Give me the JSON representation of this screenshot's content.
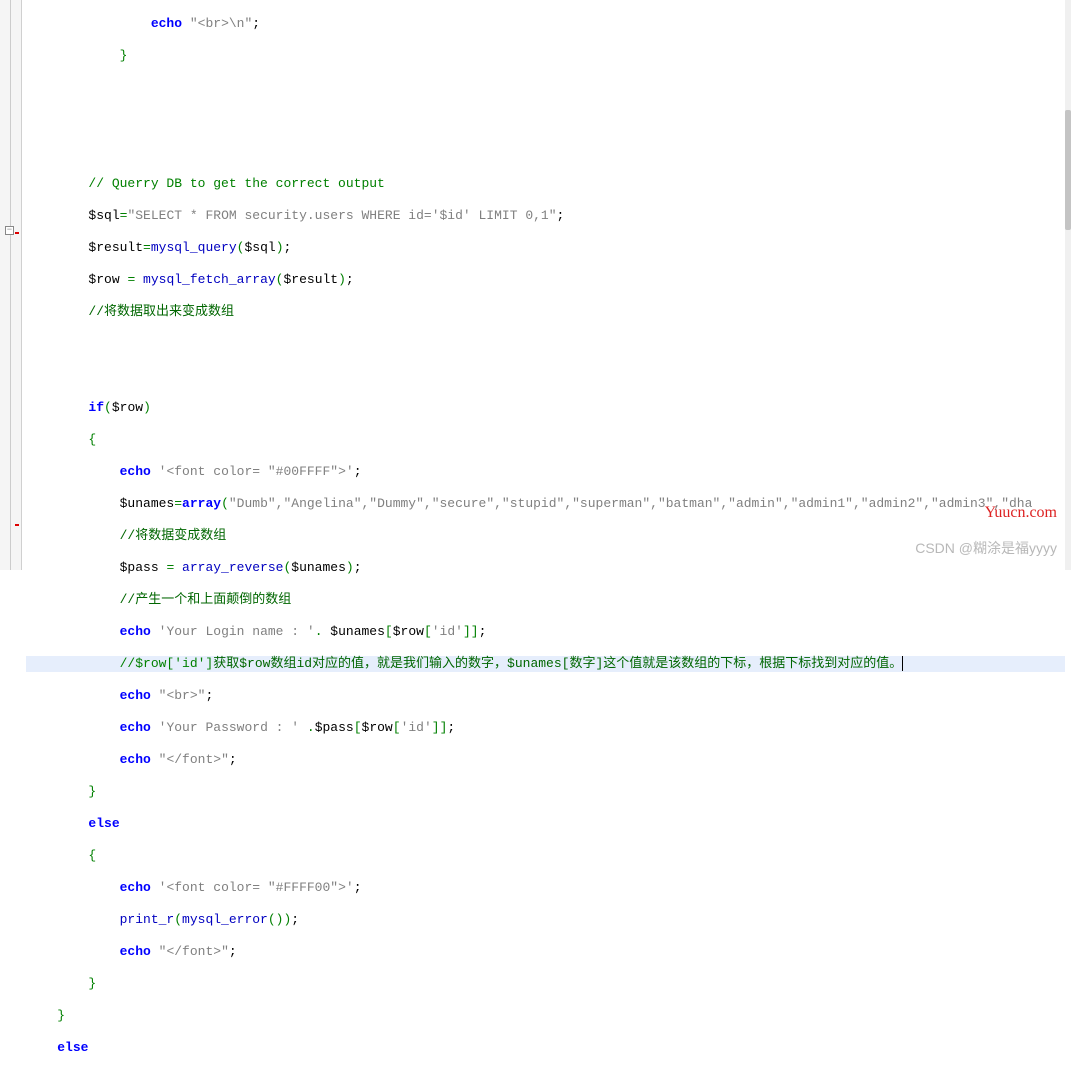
{
  "code": {
    "l0": {
      "indent": "                ",
      "kw": "echo",
      "str": "\"<br>\\n\"",
      "semi": ";"
    },
    "l1": {
      "indent": "            ",
      "brace": "}"
    },
    "l5_cmt": "        // Querry DB to get the correct output",
    "l6": {
      "indent": "        ",
      "var": "$sql",
      "op": "=",
      "str": "\"SELECT * FROM security.users WHERE id='$id' LIMIT 0,1\"",
      "semi": ";"
    },
    "l7": {
      "indent": "        ",
      "var": "$result",
      "op": "=",
      "fn": "mysql_query",
      "arg": "$sql",
      "semi": ";"
    },
    "l8": {
      "indent": "        ",
      "var": "$row",
      "eq": " = ",
      "fn": "mysql_fetch_array",
      "arg": "$result",
      "semi": ";"
    },
    "l9_cmt": "        //将数据取出来变成数组",
    "l12": {
      "indent": "        ",
      "kw": "if",
      "cond": "$row"
    },
    "l13": {
      "indent": "        ",
      "brace": "{"
    },
    "l14": {
      "indent": "            ",
      "kw": "echo",
      "str": "'<font color= \"#00FFFF\">'",
      "semi": ";"
    },
    "l15": {
      "indent": "            ",
      "var": "$unames",
      "op": "=",
      "fn": "array",
      "args_str": "\"Dumb\",\"Angelina\",\"Dummy\",\"secure\",\"stupid\",\"superman\",\"batman\",\"admin\",\"admin1\",\"admin2\",\"admin3\",\"dha"
    },
    "l16_cmt": "            //将数据变成数组",
    "l17": {
      "indent": "            ",
      "var": "$pass",
      "eq": " = ",
      "fn": "array_reverse",
      "arg": "$unames",
      "semi": ";"
    },
    "l18_cmt": "            //产生一个和上面颠倒的数组",
    "l19": {
      "indent": "            ",
      "kw": "echo",
      "str": "'Your Login name : '",
      "dot": ". ",
      "expr_var": "$unames",
      "br1": "[",
      "expr_var2": "$row",
      "br2": "[",
      "key": "'id'",
      "br3": "]]",
      "semi": ";"
    },
    "l20_cmt_a": "            //$row['id']",
    "l20_cmt_b": "获取$row数组id对应的值，就是我们输入的数字，$unames[数字]这个值就是该数组的下标，根据下标找到对应的值。",
    "l21": {
      "indent": "            ",
      "kw": "echo",
      "str": "\"<br>\"",
      "semi": ";"
    },
    "l22": {
      "indent": "            ",
      "kw": "echo",
      "str": "'Your Password : '",
      "dot": " .",
      "expr_var": "$pass",
      "br1": "[",
      "expr_var2": "$row",
      "br2": "[",
      "key": "'id'",
      "br3": "]]",
      "semi": ";"
    },
    "l23": {
      "indent": "            ",
      "kw": "echo",
      "str": "\"</font>\"",
      "semi": ";"
    },
    "l24": {
      "indent": "        ",
      "brace": "}"
    },
    "l25": {
      "indent": "        ",
      "kw": "else"
    },
    "l26": {
      "indent": "        ",
      "brace": "{"
    },
    "l27": {
      "indent": "            ",
      "kw": "echo",
      "str": "'<font color= \"#FFFF00\">'",
      "semi": ";"
    },
    "l28": {
      "indent": "            ",
      "fn": "print_r",
      "fn2": "mysql_error",
      "semi": ";"
    },
    "l29": {
      "indent": "            ",
      "kw": "echo",
      "str": "\"</font>\"",
      "semi": ";"
    },
    "l30": {
      "indent": "        ",
      "brace": "}"
    },
    "l31": {
      "indent": "    ",
      "brace": "}"
    },
    "l32": {
      "indent": "    ",
      "kw": "else"
    }
  },
  "fold_minus": "−",
  "watermark1": "Yuucn.com",
  "watermark2": "CSDN @糊涂是福yyyy"
}
